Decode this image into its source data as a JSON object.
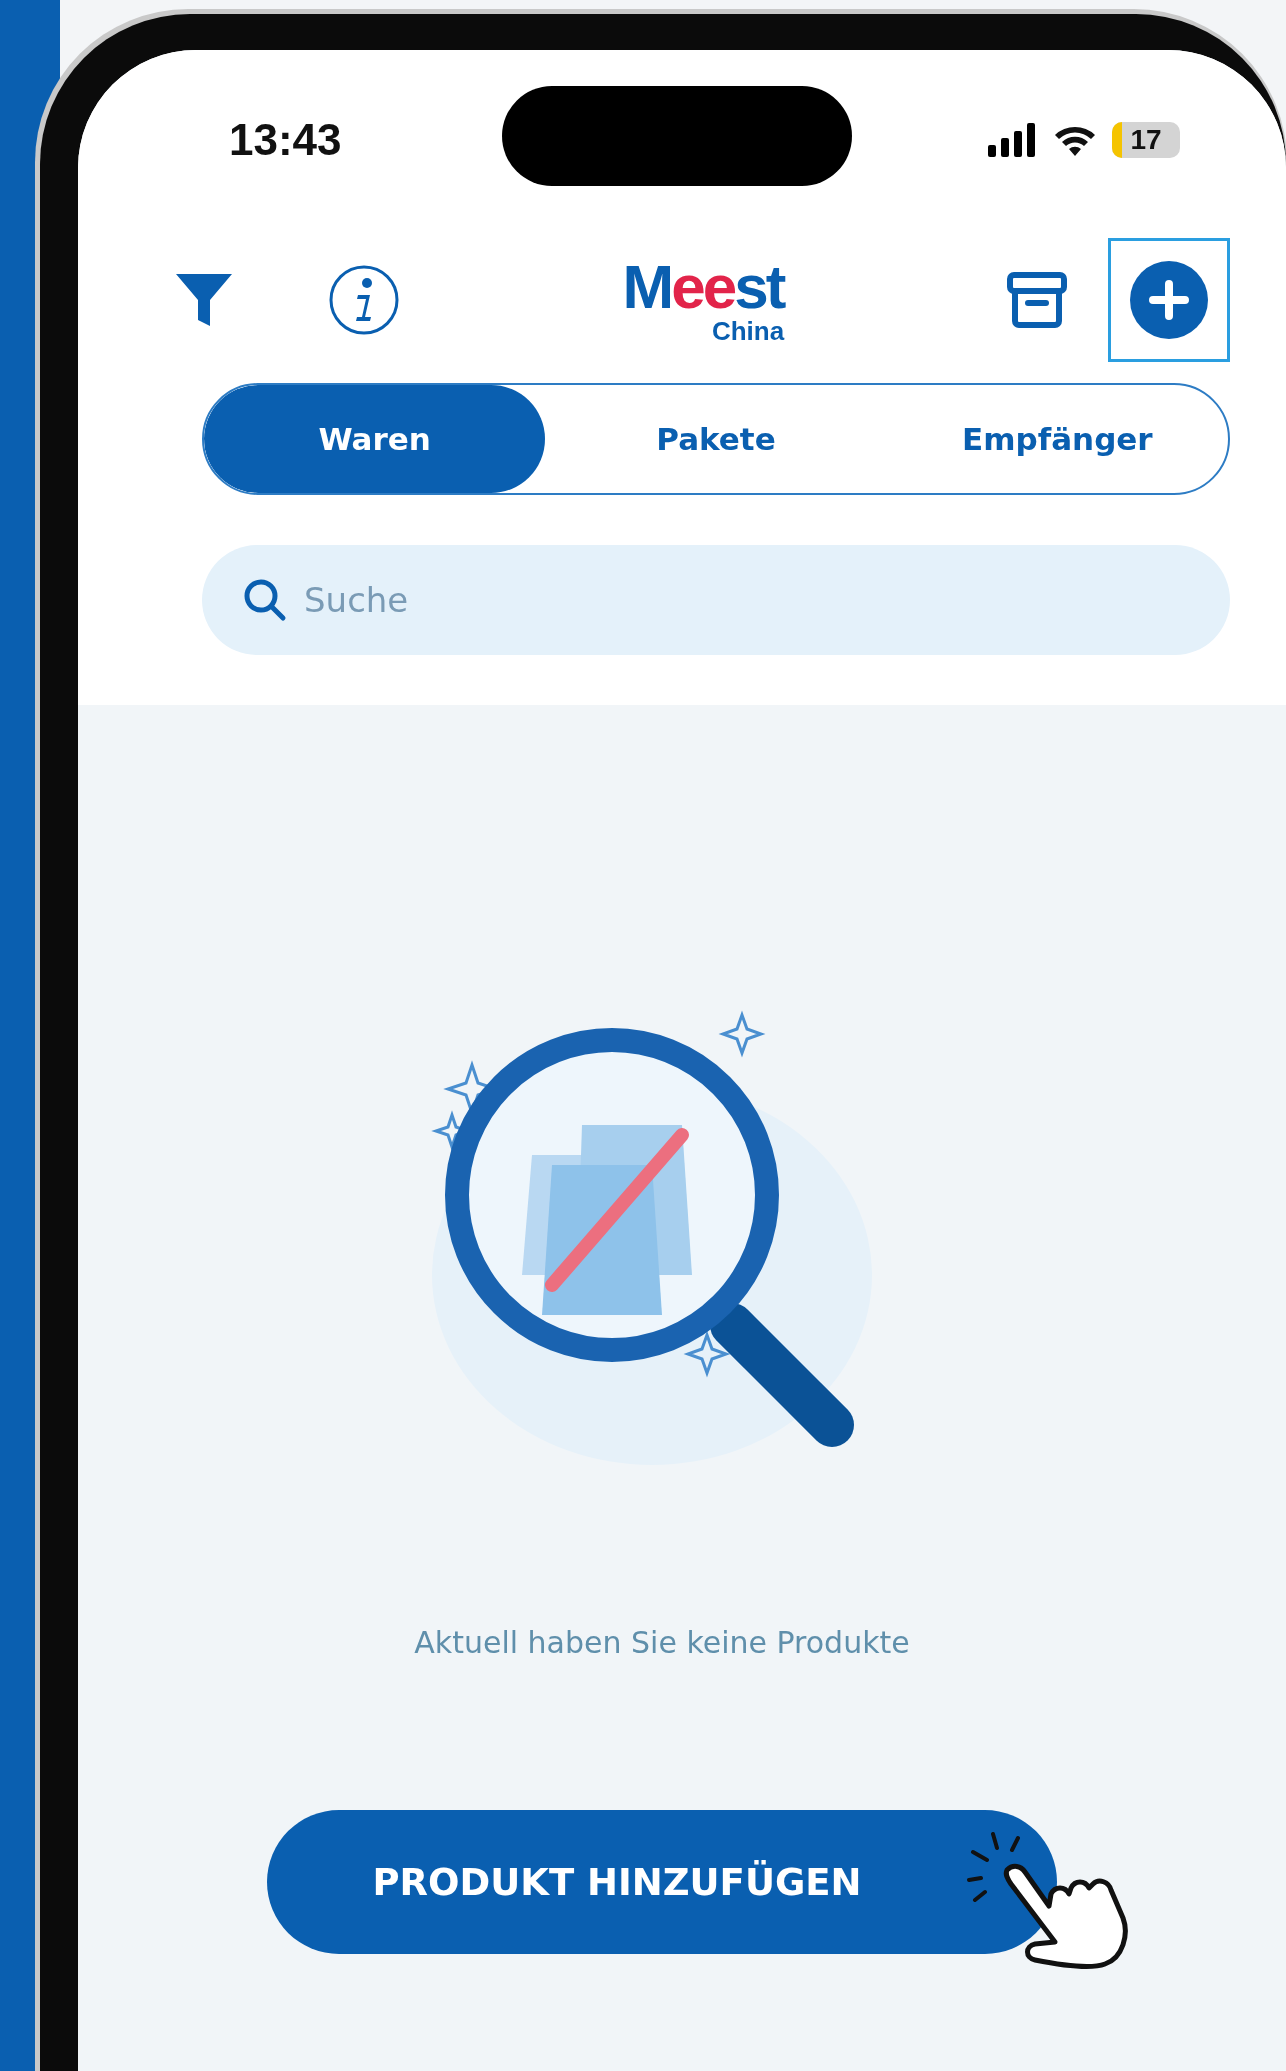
{
  "status_bar": {
    "time": "13:43",
    "battery": "17"
  },
  "header": {
    "logo": [
      "M",
      "ee",
      "st"
    ],
    "logo_sub": "China"
  },
  "tabs": [
    {
      "label": "Waren",
      "selected": true
    },
    {
      "label": "Pakete",
      "selected": false
    },
    {
      "label": "Empfänger",
      "selected": false
    }
  ],
  "search": {
    "placeholder": "Suche"
  },
  "empty_state": {
    "message": "Aktuell haben Sie keine Produkte"
  },
  "add_button": {
    "label": "PRODUKT HINZUFÜGEN"
  }
}
